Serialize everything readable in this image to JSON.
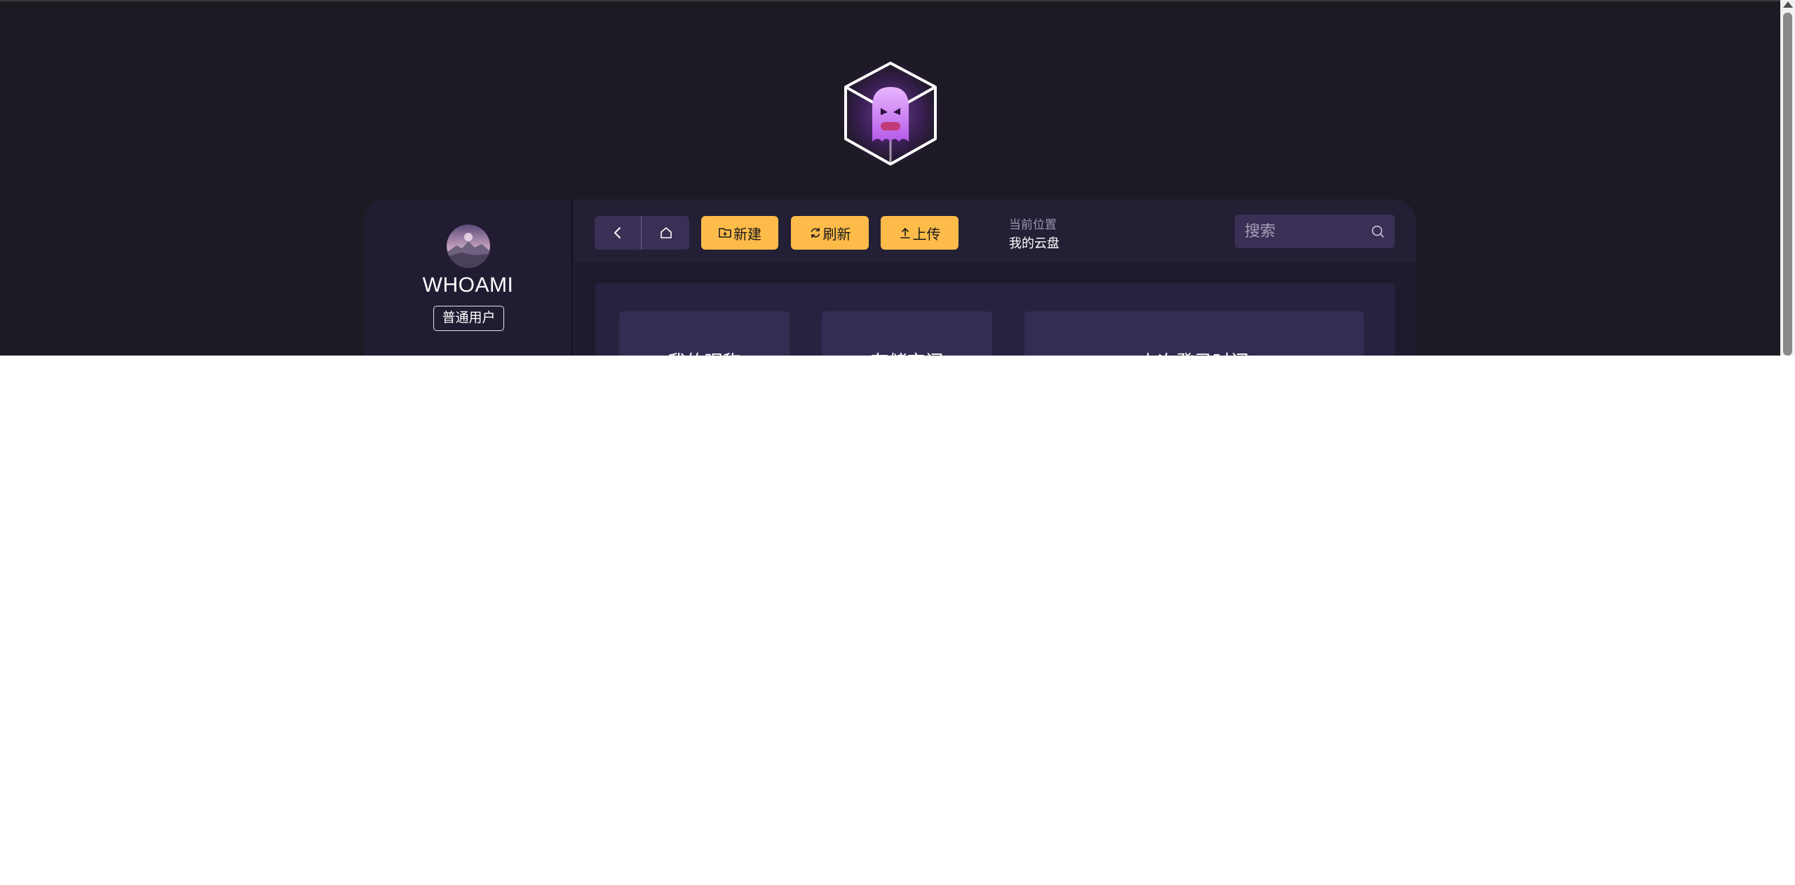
{
  "logo": {
    "icon": "ghost-cube-logo"
  },
  "user": {
    "name": "WHOAMI",
    "role": "普通用户",
    "avatar_icon": "mountain-avatar"
  },
  "toolbar": {
    "back_icon": "chevron-left-icon",
    "home_icon": "home-icon",
    "new_label": "新建",
    "refresh_label": "刷新",
    "upload_label": "上传",
    "accent": "#fdbb4a"
  },
  "location": {
    "label": "当前位置",
    "value": "我的云盘"
  },
  "search": {
    "placeholder": "搜索"
  },
  "cards": [
    {
      "title": "我的昵称"
    },
    {
      "title": "存储空间"
    },
    {
      "title": "上次登录时间"
    }
  ]
}
